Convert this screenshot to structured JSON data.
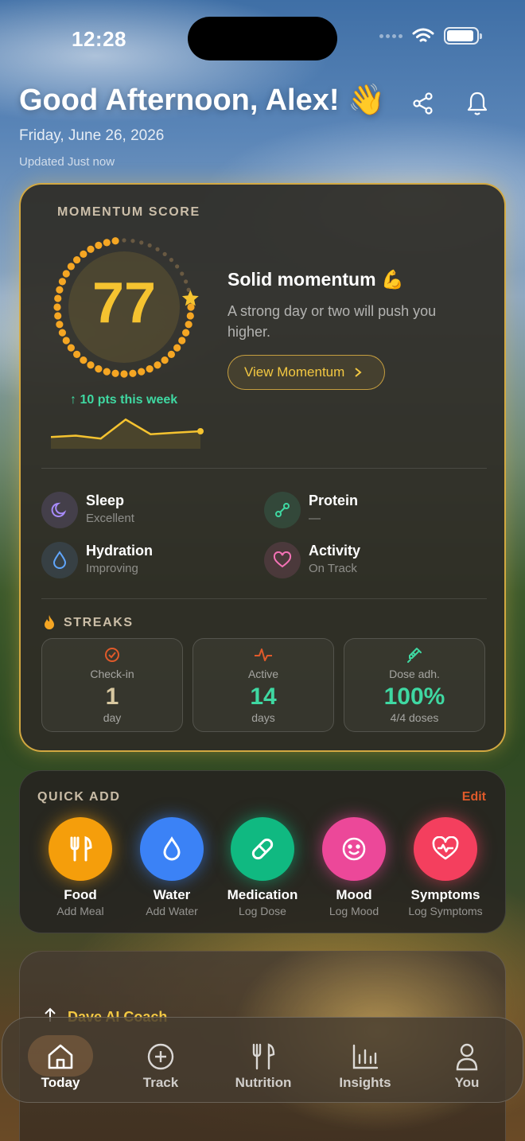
{
  "status_bar": {
    "time": "12:28",
    "battery_level": 0.92
  },
  "header": {
    "greeting": "Good Afternoon, Alex! 👋",
    "date": "Friday, June 26, 2026",
    "updated": "Updated Just now",
    "icons": [
      "share-icon",
      "bell-icon"
    ]
  },
  "momentum": {
    "label": "MOMENTUM SCORE",
    "score": "77",
    "score_fraction": 0.77,
    "weekly_change": "↑ 10 pts this week",
    "sparkline": [
      48,
      49,
      47,
      60,
      50,
      51,
      52
    ],
    "title": "Solid momentum 💪",
    "description": "A strong day or two will push you higher.",
    "button_label": "View Momentum",
    "accent_color": "#f5a623",
    "metrics": [
      {
        "name": "Sleep",
        "status": "Excellent",
        "icon": "moon-icon",
        "color": "#a78bfa"
      },
      {
        "name": "Protein",
        "status": "—",
        "icon": "protein-icon",
        "color": "#3fd8a2"
      },
      {
        "name": "Hydration",
        "status": "Improving",
        "icon": "water-drop-icon",
        "color": "#60a5fa"
      },
      {
        "name": "Activity",
        "status": "On Track",
        "icon": "heart-icon",
        "color": "#f472b6"
      }
    ],
    "streaks_label": "STREAKS",
    "streaks": [
      {
        "label": "Check-in",
        "value": "1",
        "unit": "day",
        "icon": "check-circle-icon",
        "color": "#e05a2a",
        "value_color": "#d8c8a0"
      },
      {
        "label": "Active",
        "value": "14",
        "unit": "days",
        "icon": "pulse-icon",
        "color": "#e05a2a",
        "value_color": "#3fd8a2"
      },
      {
        "label": "Dose adh.",
        "value": "100%",
        "unit": "4/4 doses",
        "icon": "syringe-icon",
        "color": "#3fd8a2",
        "value_color": "#3fd8a2"
      }
    ]
  },
  "quick_add": {
    "label": "QUICK ADD",
    "edit": "Edit",
    "items": [
      {
        "name": "Food",
        "sub": "Add Meal",
        "icon": "fork-knife-icon",
        "color": "#f59e0b"
      },
      {
        "name": "Water",
        "sub": "Add Water",
        "icon": "water-drop-icon",
        "color": "#3b82f6"
      },
      {
        "name": "Medication",
        "sub": "Log Dose",
        "icon": "pill-icon",
        "color": "#10b981"
      },
      {
        "name": "Mood",
        "sub": "Log Mood",
        "icon": "smile-icon",
        "color": "#ec4899"
      },
      {
        "name": "Symptoms",
        "sub": "Log Symptoms",
        "icon": "heart-pulse-icon",
        "color": "#f43f5e"
      }
    ]
  },
  "coach": {
    "title": "Dave AI Coach"
  },
  "tabs": [
    {
      "label": "Today",
      "icon": "home-icon",
      "active": true
    },
    {
      "label": "Track",
      "icon": "plus-circle-icon",
      "active": false
    },
    {
      "label": "Nutrition",
      "icon": "fork-knife-icon",
      "active": false
    },
    {
      "label": "Insights",
      "icon": "bar-chart-icon",
      "active": false
    },
    {
      "label": "You",
      "icon": "person-icon",
      "active": false
    }
  ]
}
